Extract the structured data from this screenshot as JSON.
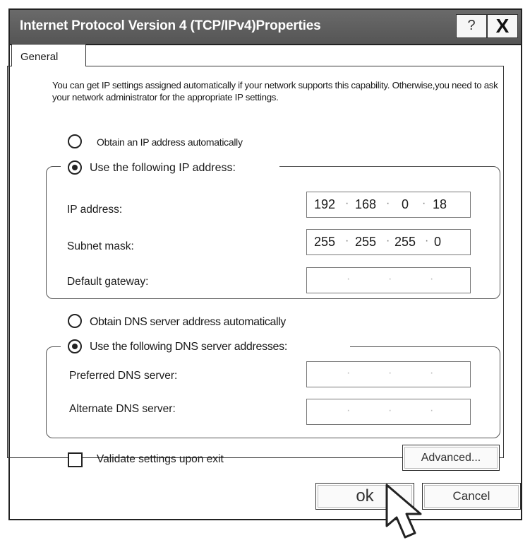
{
  "window": {
    "title": "Internet Protocol Version 4 (TCP/IPv4)Properties",
    "help_label": "?",
    "close_label": "X"
  },
  "tabs": [
    {
      "label": "General",
      "selected": true
    }
  ],
  "intro_text": "You can get IP settings assigned automatically if your network supports this capability. Otherwise,you need to ask your network administrator for the appropriate IP settings.",
  "ip_section": {
    "auto_label": "Obtain an IP address automatically",
    "auto_selected": false,
    "manual_label": "Use the following IP address:",
    "manual_selected": true,
    "fields": [
      {
        "label": "IP address:",
        "octets": [
          "192",
          "168",
          "0",
          "18"
        ]
      },
      {
        "label": "Subnet mask:",
        "octets": [
          "255",
          "255",
          "255",
          "0"
        ]
      },
      {
        "label": "Default gateway:",
        "octets": [
          "",
          "",
          "",
          ""
        ]
      }
    ]
  },
  "dns_section": {
    "auto_label": "Obtain DNS  server address automatically",
    "auto_selected": false,
    "manual_label": "Use the following DNS server addresses:",
    "manual_selected": true,
    "fields": [
      {
        "label": "Preferred DNS server:",
        "octets": [
          "",
          "",
          "",
          ""
        ]
      },
      {
        "label": "Alternate DNS server:",
        "octets": [
          "",
          "",
          "",
          ""
        ]
      }
    ]
  },
  "validate": {
    "label": "Validate settings upon exit",
    "checked": false
  },
  "buttons": {
    "advanced": "Advanced...",
    "ok": "ok",
    "cancel": "Cancel"
  },
  "cursor_icon": "arrow-cursor-icon"
}
